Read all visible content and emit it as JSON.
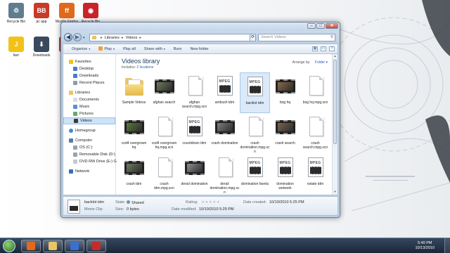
{
  "desktop": {
    "icons": [
      {
        "label": "Recycle Bin",
        "color": "#5f7d8f"
      },
      {
        "label": "pc app",
        "color": "#c63b2a"
      },
      {
        "label": "Mozilla Firefox",
        "color": "#e06a1c"
      },
      {
        "label": "Recycle Bin",
        "color": "#c9242b"
      },
      {
        "label": "liarr",
        "color": "#f2c218"
      },
      {
        "label": "Downloads",
        "color": "#3a4a5e"
      },
      {
        "label": "Recuva",
        "color": "#c83b2a"
      }
    ],
    "icon_glyphs": [
      "♲",
      "BB",
      "ff",
      "◉",
      "J",
      "⬇",
      "R"
    ]
  },
  "window": {
    "controls": {
      "minimize": "–",
      "maximize": "□",
      "close": "✕"
    },
    "nav": {
      "back": "◀",
      "forward": "▶",
      "dropdown": "▾"
    },
    "breadcrumb": [
      "Libraries",
      "Videos"
    ],
    "search_placeholder": "Search Videos",
    "toolbar": {
      "organize": "Organize",
      "play": "Play",
      "play_all": "Play all",
      "share_with": "Share with",
      "burn": "Burn",
      "new_folder": "New folder"
    },
    "view_buttons": [
      "▦",
      "▭",
      "?"
    ]
  },
  "nav_pane": {
    "favorites": {
      "label": "Favorites",
      "items": [
        "Desktop",
        "Downloads",
        "Recent Places"
      ]
    },
    "libraries": {
      "label": "Libraries",
      "items": [
        "Documents",
        "Music",
        "Pictures",
        "Videos"
      ],
      "selected": "Videos"
    },
    "homegroup": "Homegroup",
    "computer": {
      "label": "Computer",
      "items": [
        "OS (C:)",
        "Removable Disk (D:)",
        "DVD RW Drive (E:) G"
      ]
    },
    "network": "Network"
  },
  "library": {
    "title": "Videos library",
    "includes_label": "Includes:",
    "includes_value": "2 locations",
    "arrange_label": "Arrange by:",
    "arrange_value": "Folder"
  },
  "files": [
    {
      "name": "Sample Videos",
      "type": "folder"
    },
    {
      "name": "afghan search",
      "type": "video",
      "tint": "#6b7a5a"
    },
    {
      "name": "afghan search.mpg.scn",
      "type": "doc"
    },
    {
      "name": "ambush tdm",
      "type": "mpeg"
    },
    {
      "name": "backlot tdm",
      "type": "mpeg",
      "selected": true
    },
    {
      "name": "bog hq",
      "type": "video",
      "tint": "#8a6a4a"
    },
    {
      "name": "bog hq.mpg.scn",
      "type": "doc"
    },
    {
      "name": "cod4 overgrown hq",
      "type": "video",
      "tint": "#5c7a3a"
    },
    {
      "name": "cod4 overgrown hq.mpg.scn",
      "type": "doc"
    },
    {
      "name": "countdown tdm",
      "type": "mpeg"
    },
    {
      "name": "crash domination",
      "type": "video",
      "tint": "#7a7f86"
    },
    {
      "name": "crash domination.mpg.scn",
      "type": "doc"
    },
    {
      "name": "crash search",
      "type": "video",
      "tint": "#7b6552"
    },
    {
      "name": "crash search.mpg.scn",
      "type": "doc"
    },
    {
      "name": "crash tdm",
      "type": "video",
      "tint": "#6e7c5e"
    },
    {
      "name": "crash tdm.mpg.scn",
      "type": "doc"
    },
    {
      "name": "derail domination",
      "type": "video",
      "tint": "#8c8f94"
    },
    {
      "name": "derail domination.mpg.scn",
      "type": "doc"
    },
    {
      "name": "domination favela",
      "type": "mpeg"
    },
    {
      "name": "domination wetwork",
      "type": "mpeg"
    },
    {
      "name": "estate tdm",
      "type": "mpeg"
    }
  ],
  "details": {
    "name": "backlot tdm",
    "type": "Movie Clip",
    "state_label": "State:",
    "state_value": "Shared",
    "size_label": "Size:",
    "size_value": "0 bytes",
    "rating_label": "Rating:",
    "rating_stars": "★★★★★",
    "created_label": "Date created:",
    "created_value": "10/10/2010 5:25 PM",
    "modified_label": "Date modified:",
    "modified_value": "10/10/2010 5:25 PM"
  },
  "taskbar": {
    "time": "5:40 PM",
    "date": "10/13/2010",
    "apps": [
      {
        "name": "firefox",
        "color": "#e06a1c"
      },
      {
        "name": "explorer",
        "color": "#e8c566"
      },
      {
        "name": "media-player",
        "color": "#3b6fd1"
      },
      {
        "name": "app",
        "color": "#c42c2c"
      }
    ]
  }
}
